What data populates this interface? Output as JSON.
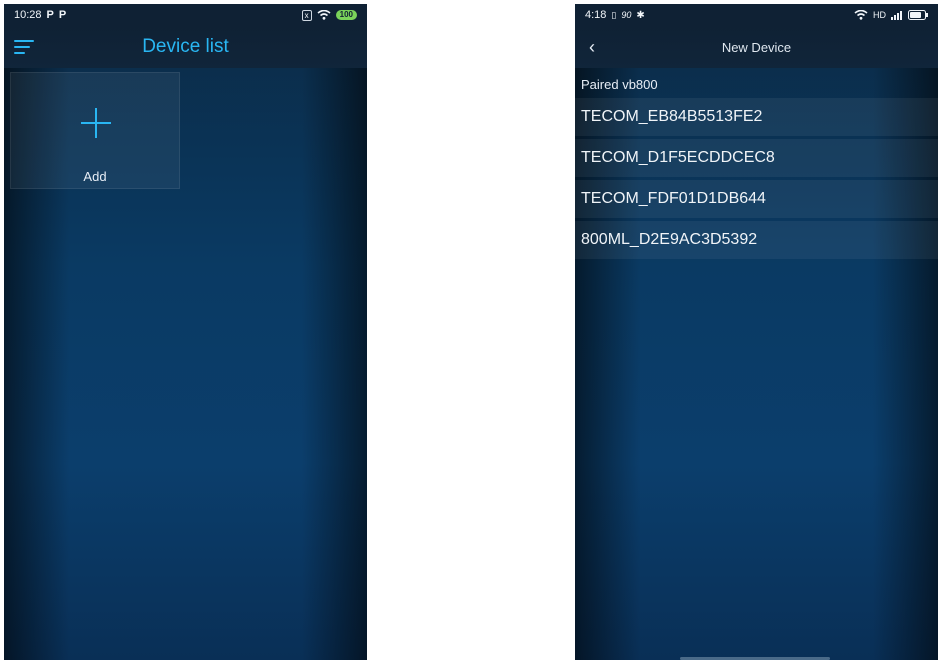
{
  "left_screen": {
    "status": {
      "time": "10:28",
      "notif_icons": [
        "P",
        "P"
      ],
      "sim_box": "x",
      "battery": "100"
    },
    "title": "Device list",
    "add_label": "Add"
  },
  "right_screen": {
    "status": {
      "time": "4:18",
      "mid_text": "90",
      "right_text": "HD"
    },
    "title": "New Device",
    "section_label": "Paired vb800",
    "devices": [
      "TECOM_EB84B5513FE2",
      "TECOM_D1F5ECDDCEC8",
      "TECOM_FDF01D1DB644",
      "800ML_D2E9AC3D5392"
    ]
  },
  "colors": {
    "accent": "#29b6f2",
    "bg": "#0a3a63"
  }
}
